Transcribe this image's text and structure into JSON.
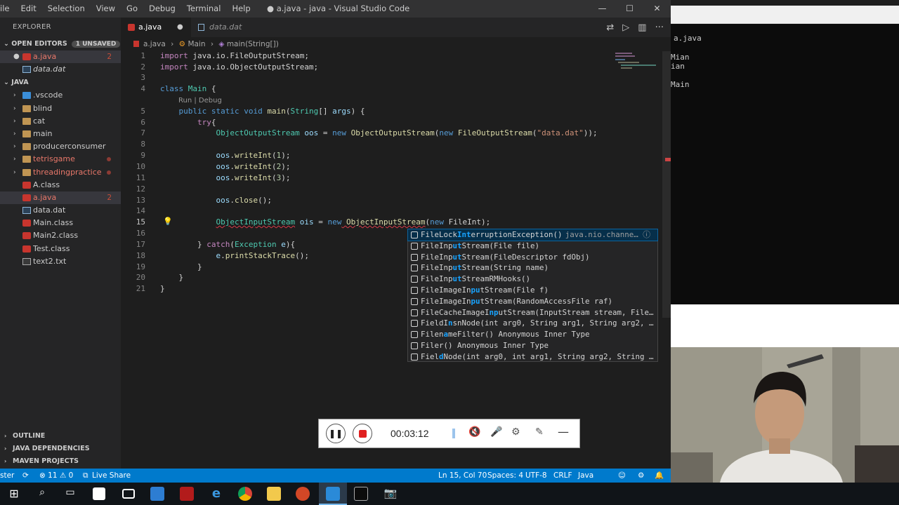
{
  "menu": [
    "ile",
    "Edit",
    "Selection",
    "View",
    "Go",
    "Debug",
    "Terminal",
    "Help"
  ],
  "window_title": "● a.java - java - Visual Studio Code",
  "window_controls": {
    "minimize": "—",
    "maximize": "☐",
    "close": "✕"
  },
  "sidebar": {
    "title": "EXPLORER",
    "open_editors": {
      "label": "OPEN EDITORS",
      "badge": "1 UNSAVED",
      "items": [
        {
          "name": "a.java",
          "problems": "2"
        },
        {
          "name": "data.dat"
        }
      ]
    },
    "folder": {
      "label": "JAVA",
      "folders": [
        ".vscode",
        "blind",
        "cat",
        "main",
        "producerconsumer",
        "tetrisgame",
        "threadingpractice"
      ],
      "files": [
        {
          "name": "A.class"
        },
        {
          "name": "a.java",
          "problems": "2"
        },
        {
          "name": "data.dat"
        },
        {
          "name": "Main.class"
        },
        {
          "name": "Main2.class"
        },
        {
          "name": "Test.class"
        },
        {
          "name": "text2.txt"
        }
      ]
    },
    "outline": "OUTLINE",
    "java_deps": "JAVA DEPENDENCIES",
    "maven": "MAVEN PROJECTS"
  },
  "tabs": [
    {
      "label": "a.java"
    },
    {
      "label": "data.dat"
    }
  ],
  "breadcrumb": {
    "file": "a.java",
    "sep": "›",
    "cls": "Main",
    "method": "main(String[])"
  },
  "editor": {
    "line_numbers": [
      "1",
      "2",
      "3",
      "4",
      "5",
      "6",
      "7",
      "8",
      "9",
      "10",
      "11",
      "12",
      "13",
      "14",
      "15",
      "16",
      "17",
      "18",
      "19",
      "20",
      "21"
    ],
    "code_lens": "Run | Debug",
    "lines": {
      "l1a": "import",
      "l1b": " java.io.FileOutputStream;",
      "l2a": "import",
      "l2b": " java.io.ObjectOutputStream;",
      "l4a": "class",
      "l4b": " Main",
      "l4c": " {",
      "l5a": "    public static void",
      "l5b": " main",
      "l5c": "(",
      "l5d": "String",
      "l5e": "[] ",
      "l5f": "args",
      "l5g": ") {",
      "l6a": "        try",
      "l6b": "{",
      "l7a": "            ",
      "l7b": "ObjectOutputStream",
      "l7c": " oos",
      "l7d": " = ",
      "l7e": "new",
      "l7f": " ObjectOutputStream",
      "l7g": "(",
      "l7h": "new",
      "l7i": " FileOutputStream",
      "l7j": "(",
      "l7k": "\"data.dat\"",
      "l7l": "));",
      "l9a": "            ",
      "l9b": "oos",
      "l9c": ".",
      "l9d": "writeInt",
      "l9e": "(",
      "l9f": "1",
      "l9g": ");",
      "l10a": "            ",
      "l10b": "oos",
      "l10c": ".",
      "l10d": "writeInt",
      "l10e": "(",
      "l10f": "2",
      "l10g": ");",
      "l11a": "            ",
      "l11b": "oos",
      "l11c": ".",
      "l11d": "writeInt",
      "l11e": "(",
      "l11f": "3",
      "l11g": ");",
      "l13a": "            ",
      "l13b": "oos",
      "l13c": ".",
      "l13d": "close",
      "l13e": "();",
      "l15a": "            ",
      "l15b": "ObjectInputStream",
      "l15c": " ois",
      "l15d": " = ",
      "l15e": "new",
      "l15f": " ObjectInputStream",
      "l15g": "(",
      "l15h": "new",
      "l15i": " FileInt",
      "l15j": ");",
      "l17a": "        } ",
      "l17b": "catch",
      "l17c": "(",
      "l17d": "Exception",
      "l17e": " e",
      "l17f": "){",
      "l18a": "            ",
      "l18b": "e",
      "l18c": ".",
      "l18d": "printStackTrace",
      "l18e": "();",
      "l19": "        }",
      "l20": "    }",
      "l21": "}"
    }
  },
  "suggestions": [
    {
      "pre": "FileLock",
      "hl": "Int",
      "rest": "erruptionException()",
      "detail": "java.nio.channe… ⓘ"
    },
    {
      "pre": "FileInp",
      "hl": "ut",
      "rest": "Stream(File file)",
      "detail": ""
    },
    {
      "pre": "FileInp",
      "hl": "ut",
      "rest": "Stream(FileDescriptor fdObj)",
      "detail": ""
    },
    {
      "pre": "FileInp",
      "hl": "ut",
      "rest": "Stream(String name)",
      "detail": ""
    },
    {
      "pre": "FileInp",
      "hl": "ut",
      "rest": "StreamRMHooks()",
      "detail": ""
    },
    {
      "pre": "FileImageIn",
      "hl": "pu",
      "rest": "tStream(File f)",
      "detail": ""
    },
    {
      "pre": "FileImageIn",
      "hl": "pu",
      "rest": "tStream(RandomAccessFile raf)",
      "detail": ""
    },
    {
      "pre": "FileCacheImageI",
      "hl": "np",
      "rest": "utStream(InputStream stream, File…",
      "detail": ""
    },
    {
      "pre": "FieldI",
      "hl": "n",
      "rest": "snNode(int arg0, String arg1, String arg2, …",
      "detail": ""
    },
    {
      "pre": "Filen",
      "hl": "a",
      "rest": "meFilter()  Anonymous Inner Type",
      "detail": ""
    },
    {
      "pre": "Filer",
      "hl": "",
      "rest": "()  Anonymous Inner Type",
      "detail": ""
    },
    {
      "pre": "Fiel",
      "hl": "d",
      "rest": "Node(int arg0, int arg1, String arg2, String …",
      "detail": ""
    }
  ],
  "statusbar": {
    "branch": "ster",
    "errors": "⊗ 11 ⚠ 0",
    "liveshare": "Live Share",
    "position": "Ln 15, Col 70",
    "spaces": "Spaces: 4",
    "encoding": "UTF-8",
    "eol": "CRLF",
    "language": "Java"
  },
  "console_lines": [
    "a.java",
    "Mian",
    "ian",
    "Main"
  ],
  "recorder": {
    "time": "00:03:12"
  },
  "colors": {
    "accent": "#007acc",
    "editor_bg": "#1e1e1e",
    "sidebar_bg": "#252526"
  }
}
